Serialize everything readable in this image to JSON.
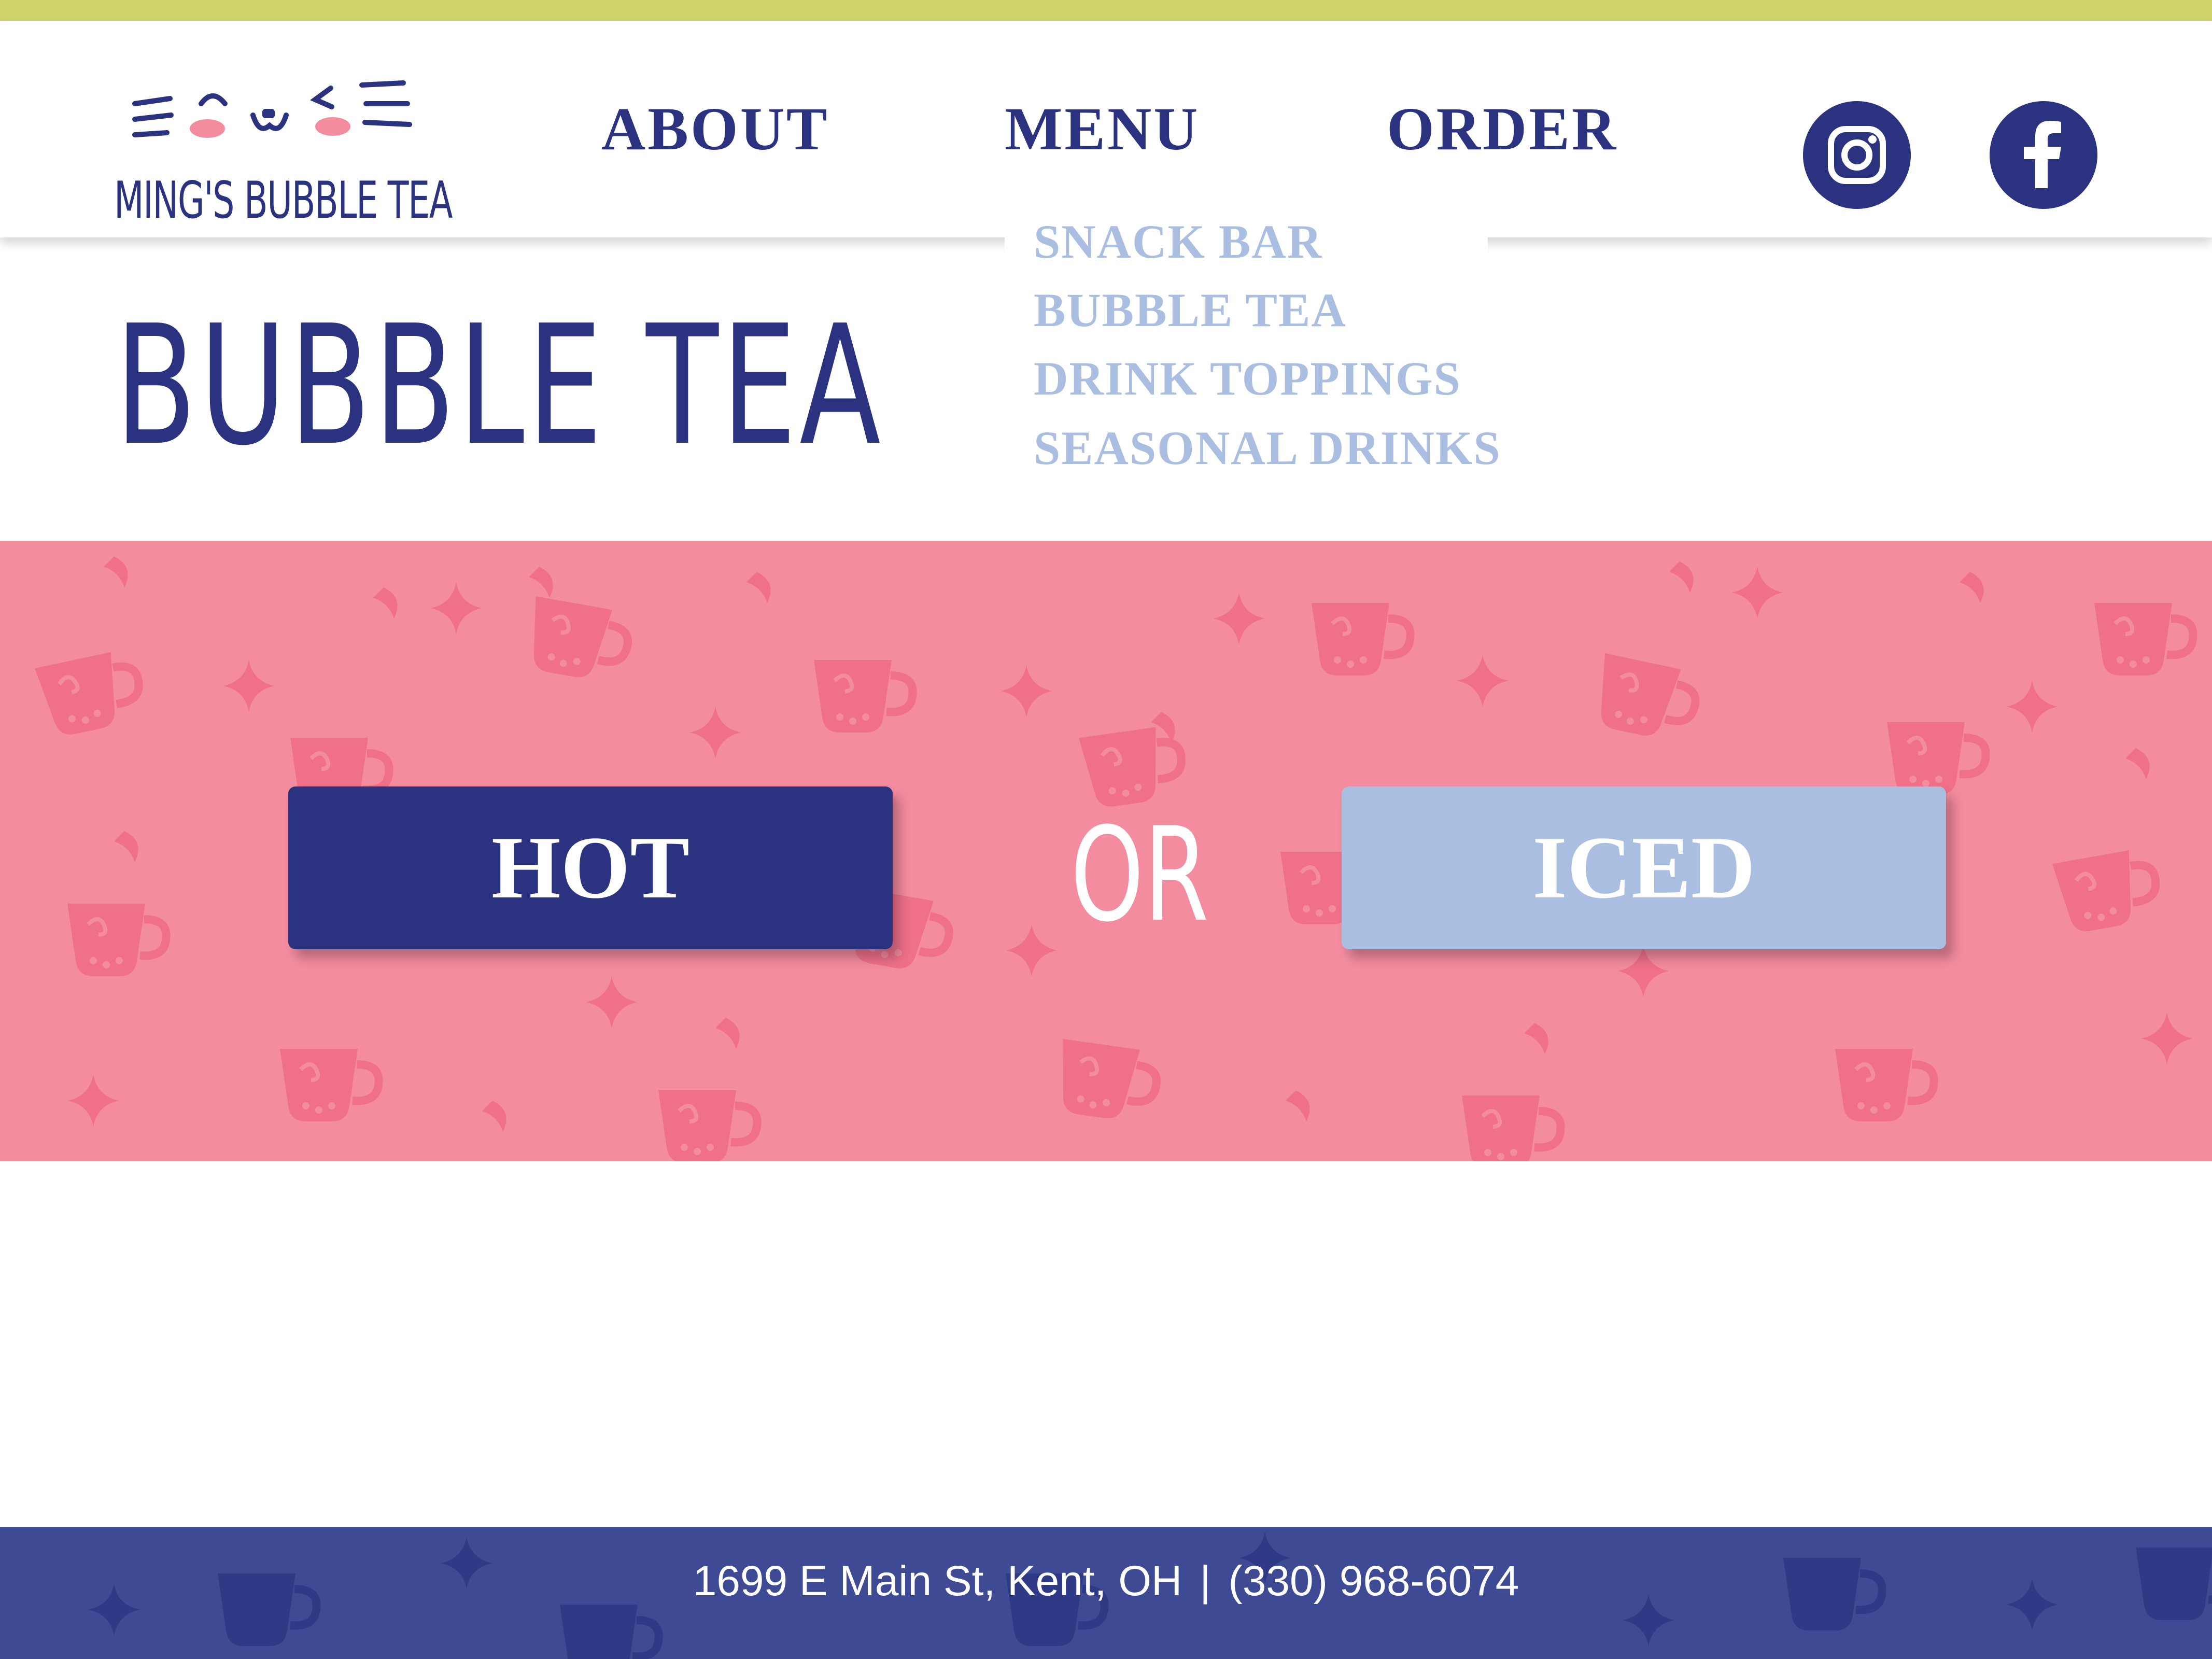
{
  "brand": {
    "name": "MING'S BUBBLE TEA",
    "colors": {
      "accent_bar": "#d0d46a",
      "navy": "#2b327f",
      "periwinkle": "#aabee2",
      "pink": "#f48c9f",
      "footer": "#3e4a93"
    }
  },
  "nav": {
    "about": "ABOUT",
    "menu": "MENU",
    "order": "ORDER"
  },
  "social": {
    "instagram_icon": "instagram-icon",
    "facebook_icon": "facebook-icon"
  },
  "dropdown": {
    "items": [
      "SNACK BAR",
      "BUBBLE TEA",
      "DRINK TOPPINGS",
      "SEASONAL DRINKS"
    ]
  },
  "page": {
    "title": "BUBBLE TEA"
  },
  "choice": {
    "hot_label": "HOT",
    "or_label": "OR",
    "iced_label": "ICED"
  },
  "footer": {
    "address": "1699 E Main St, Kent, OH",
    "separator": "|",
    "phone": "(330) 968-6074"
  }
}
